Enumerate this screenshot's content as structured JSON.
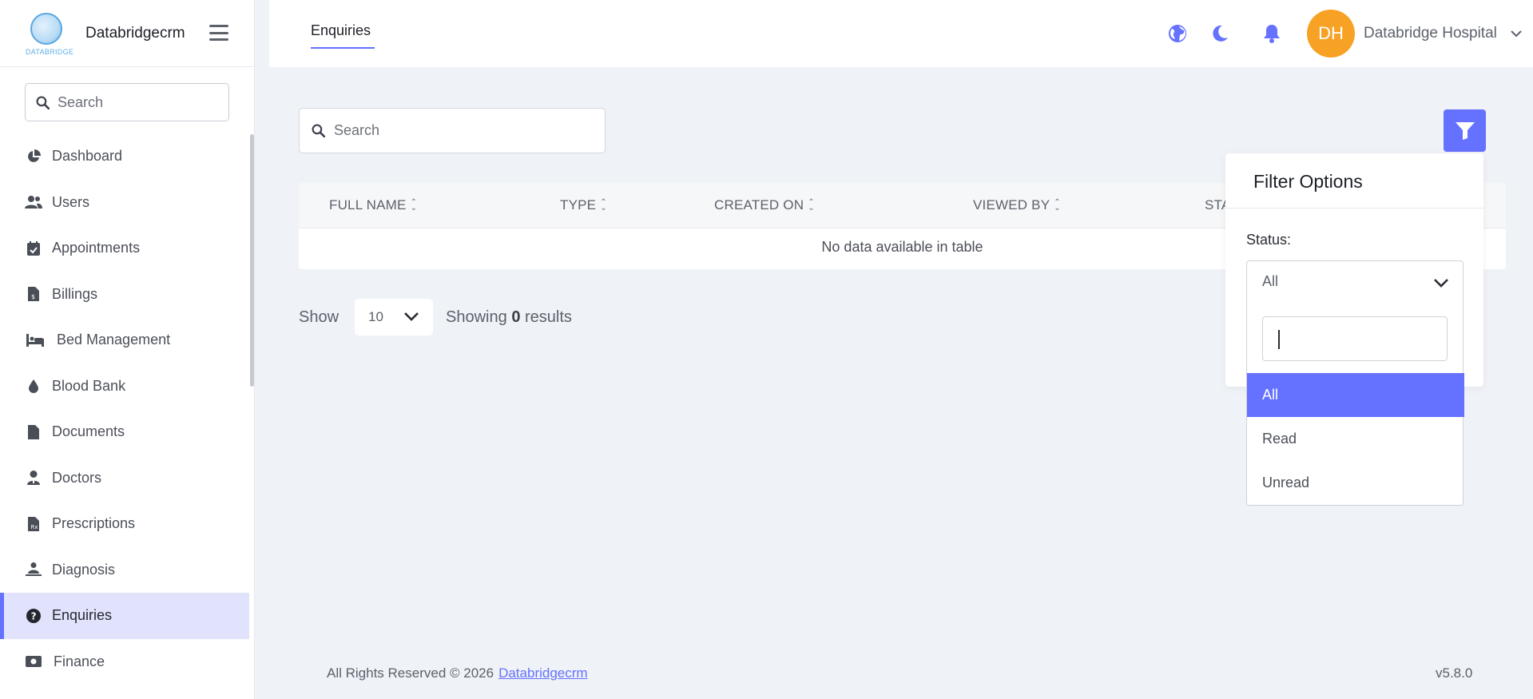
{
  "brand": {
    "name": "Databridgecrm",
    "logo_text": "DATABRIDGE"
  },
  "sidebar": {
    "search_placeholder": "Search",
    "items": [
      {
        "label": "Dashboard",
        "icon": "pie-chart-icon"
      },
      {
        "label": "Users",
        "icon": "users-icon"
      },
      {
        "label": "Appointments",
        "icon": "calendar-check-icon"
      },
      {
        "label": "Billings",
        "icon": "invoice-icon"
      },
      {
        "label": "Bed Management",
        "icon": "bed-icon"
      },
      {
        "label": "Blood Bank",
        "icon": "blood-drop-icon"
      },
      {
        "label": "Documents",
        "icon": "file-icon"
      },
      {
        "label": "Doctors",
        "icon": "doctor-icon"
      },
      {
        "label": "Prescriptions",
        "icon": "prescription-icon"
      },
      {
        "label": "Diagnosis",
        "icon": "diagnosis-icon"
      },
      {
        "label": "Enquiries",
        "icon": "question-circle-icon",
        "active": true
      },
      {
        "label": "Finance",
        "icon": "money-icon"
      }
    ]
  },
  "header": {
    "tab_label": "Enquiries",
    "avatar_initials": "DH",
    "user_name": "Databridge Hospital",
    "icons": [
      "globe-icon",
      "moon-icon",
      "bell-icon"
    ]
  },
  "main": {
    "search_placeholder": "Search",
    "table": {
      "columns": [
        "FULL NAME",
        "TYPE",
        "CREATED ON",
        "VIEWED BY",
        "STA"
      ],
      "empty_text": "No data available in table"
    },
    "pager": {
      "show_label": "Show",
      "page_size": "10",
      "showing_prefix": "Showing",
      "showing_count": "0",
      "showing_suffix": "results"
    }
  },
  "filter": {
    "title": "Filter Options",
    "status_label": "Status:",
    "selected": "All",
    "search_value": "",
    "options": [
      "All",
      "Read",
      "Unread"
    ]
  },
  "footer": {
    "copyright": "All Rights Reserved © 2026",
    "link_text": "Databridgecrm",
    "version": "v5.8.0"
  },
  "colors": {
    "accent": "#6571ff",
    "avatar": "#f7a224",
    "background": "#eff2f7"
  }
}
